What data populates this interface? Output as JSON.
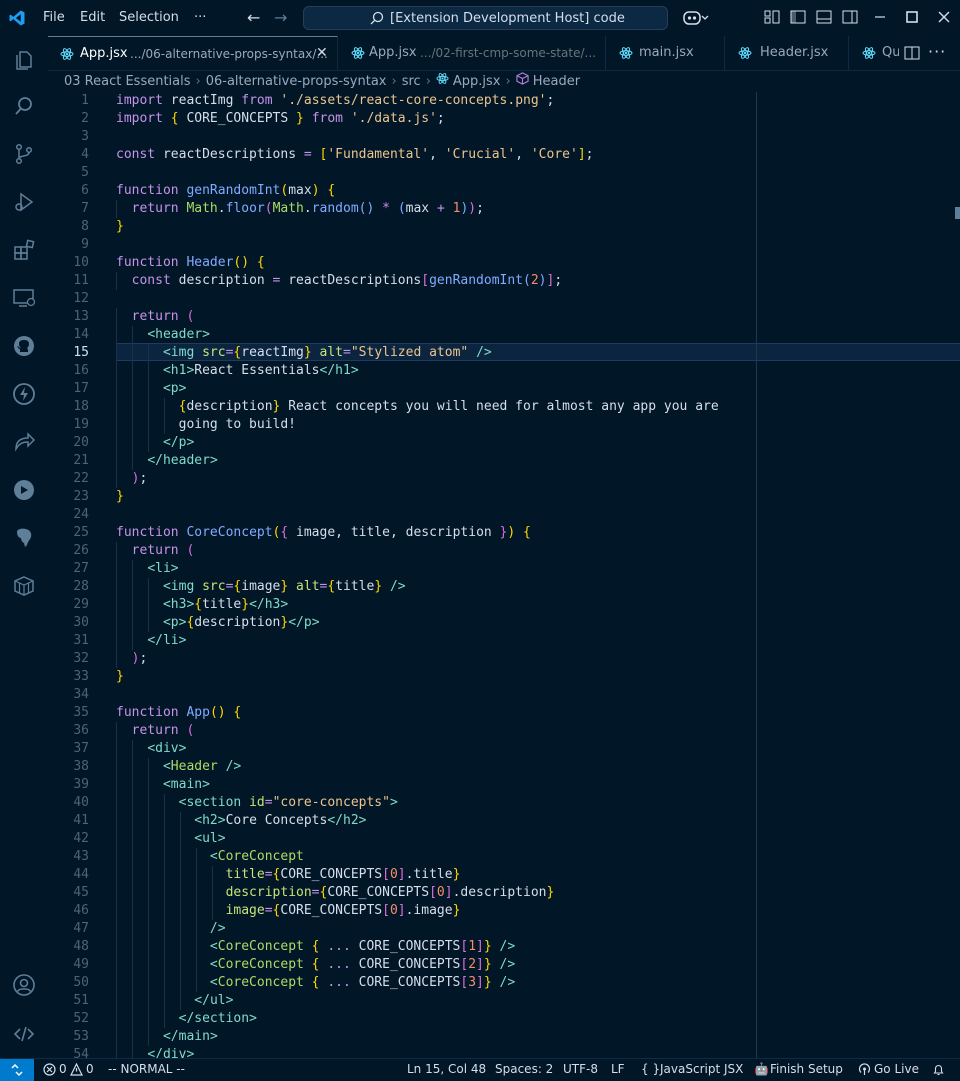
{
  "titlebar": {
    "menu": [
      "File",
      "Edit",
      "Selection",
      "···"
    ],
    "command_center": "[Extension Development Host] code"
  },
  "tabs": [
    {
      "name": "App.jsx",
      "path": ".../06-alternative-props-syntax/...",
      "active": true
    },
    {
      "name": "App.jsx",
      "path": ".../02-first-cmp-some-state/...",
      "active": false
    },
    {
      "name": "main.jsx",
      "path": "",
      "active": false
    },
    {
      "name": "Header.jsx",
      "path": "",
      "active": false
    },
    {
      "name": "Qu",
      "path": "",
      "active": false
    }
  ],
  "breadcrumb": [
    "03 React Essentials",
    "06-alternative-props-syntax",
    "src",
    "App.jsx",
    "Header"
  ],
  "editor": {
    "current_line": 15,
    "line_numbers": [
      "1",
      "2",
      "3",
      "4",
      "5",
      "6",
      "7",
      "8",
      "9",
      "10",
      "11",
      "12",
      "13",
      "14",
      "15",
      "16",
      "17",
      "18",
      "19",
      "20",
      "21",
      "22",
      "23",
      "24",
      "25",
      "26",
      "27",
      "28",
      "29",
      "30",
      "31",
      "32",
      "33",
      "34",
      "35",
      "36",
      "37",
      "38",
      "39",
      "40",
      "41",
      "42",
      "43",
      "44",
      "45",
      "46",
      "47",
      "48",
      "49",
      "50",
      "51",
      "52",
      "53",
      "54"
    ],
    "lines": [
      [
        [
          "k",
          "import "
        ],
        [
          "v",
          "reactImg "
        ],
        [
          "k",
          "from "
        ],
        [
          "s",
          "'./assets/react-core-concepts.png'"
        ],
        [
          "v",
          ";"
        ]
      ],
      [
        [
          "k",
          "import "
        ],
        [
          "p",
          "{ "
        ],
        [
          "v",
          "CORE_CONCEPTS "
        ],
        [
          "p",
          "} "
        ],
        [
          "k",
          "from "
        ],
        [
          "s",
          "'./data.js'"
        ],
        [
          "v",
          ";"
        ]
      ],
      [],
      [
        [
          "k",
          "const "
        ],
        [
          "v",
          "reactDescriptions "
        ],
        [
          "k",
          "= "
        ],
        [
          "p",
          "["
        ],
        [
          "s",
          "'Fundamental'"
        ],
        [
          "v",
          ", "
        ],
        [
          "s",
          "'Crucial'"
        ],
        [
          "v",
          ", "
        ],
        [
          "s",
          "'Core'"
        ],
        [
          "p",
          "]"
        ],
        [
          "v",
          ";"
        ]
      ],
      [],
      [
        [
          "k",
          "function "
        ],
        [
          "f",
          "genRandomInt"
        ],
        [
          "p",
          "("
        ],
        [
          "v",
          "max"
        ],
        [
          "p",
          ") {"
        ]
      ],
      [
        [
          "v",
          "  "
        ],
        [
          "k",
          "return "
        ],
        [
          "c",
          "Math"
        ],
        [
          "v",
          "."
        ],
        [
          "f",
          "floor"
        ],
        [
          "br2",
          "("
        ],
        [
          "c",
          "Math"
        ],
        [
          "v",
          "."
        ],
        [
          "f",
          "random"
        ],
        [
          "f",
          "() "
        ],
        [
          "k",
          "* "
        ],
        [
          "f",
          "("
        ],
        [
          "v",
          "max "
        ],
        [
          "k",
          "+ "
        ],
        [
          "n",
          "1"
        ],
        [
          "f",
          ")"
        ],
        [
          "br2",
          ")"
        ],
        [
          "v",
          ";"
        ]
      ],
      [
        [
          "p",
          "}"
        ]
      ],
      [],
      [
        [
          "k",
          "function "
        ],
        [
          "f",
          "Header"
        ],
        [
          "p",
          "() {"
        ]
      ],
      [
        [
          "v",
          "  "
        ],
        [
          "k",
          "const "
        ],
        [
          "v",
          "description "
        ],
        [
          "k",
          "= "
        ],
        [
          "v",
          "reactDescriptions"
        ],
        [
          "br2",
          "["
        ],
        [
          "f",
          "genRandomInt"
        ],
        [
          "f",
          "("
        ],
        [
          "n",
          "2"
        ],
        [
          "f",
          ")"
        ],
        [
          "br2",
          "]"
        ],
        [
          "v",
          ";"
        ]
      ],
      [],
      [
        [
          "v",
          "  "
        ],
        [
          "k",
          "return "
        ],
        [
          "br2",
          "("
        ]
      ],
      [
        [
          "v",
          "    "
        ],
        [
          "t",
          "<"
        ],
        [
          "t",
          "header"
        ],
        [
          "t",
          ">"
        ]
      ],
      [
        [
          "v",
          "      "
        ],
        [
          "t",
          "<"
        ],
        [
          "t",
          "img "
        ],
        [
          "a",
          "src"
        ],
        [
          "k",
          "="
        ],
        [
          "p",
          "{"
        ],
        [
          "v",
          "reactImg"
        ],
        [
          "p",
          "} "
        ],
        [
          "a",
          "alt"
        ],
        [
          "k",
          "="
        ],
        [
          "s",
          "\"Stylized atom\" "
        ],
        [
          "t",
          "/>"
        ]
      ],
      [
        [
          "v",
          "      "
        ],
        [
          "t",
          "<"
        ],
        [
          "t",
          "h1"
        ],
        [
          "t",
          ">"
        ],
        [
          "v",
          "React Essentials"
        ],
        [
          "t",
          "</"
        ],
        [
          "t",
          "h1"
        ],
        [
          "t",
          ">"
        ]
      ],
      [
        [
          "v",
          "      "
        ],
        [
          "t",
          "<"
        ],
        [
          "t",
          "p"
        ],
        [
          "t",
          ">"
        ]
      ],
      [
        [
          "v",
          "        "
        ],
        [
          "p",
          "{"
        ],
        [
          "v",
          "description"
        ],
        [
          "p",
          "} "
        ],
        [
          "v",
          "React concepts you will need for almost any app you are"
        ]
      ],
      [
        [
          "v",
          "        going to build!"
        ]
      ],
      [
        [
          "v",
          "      "
        ],
        [
          "t",
          "</"
        ],
        [
          "t",
          "p"
        ],
        [
          "t",
          ">"
        ]
      ],
      [
        [
          "v",
          "    "
        ],
        [
          "t",
          "</"
        ],
        [
          "t",
          "header"
        ],
        [
          "t",
          ">"
        ]
      ],
      [
        [
          "v",
          "  "
        ],
        [
          "br2",
          ")"
        ],
        [
          "v",
          ";"
        ]
      ],
      [
        [
          "p",
          "}"
        ]
      ],
      [],
      [
        [
          "k",
          "function "
        ],
        [
          "f",
          "CoreConcept"
        ],
        [
          "p",
          "("
        ],
        [
          "br2",
          "{ "
        ],
        [
          "v",
          "image"
        ],
        [
          "v",
          ", "
        ],
        [
          "v",
          "title"
        ],
        [
          "v",
          ", "
        ],
        [
          "v",
          "description "
        ],
        [
          "br2",
          "}"
        ],
        [
          "p",
          ") {"
        ]
      ],
      [
        [
          "v",
          "  "
        ],
        [
          "k",
          "return "
        ],
        [
          "br2",
          "("
        ]
      ],
      [
        [
          "v",
          "    "
        ],
        [
          "t",
          "<"
        ],
        [
          "t",
          "li"
        ],
        [
          "t",
          ">"
        ]
      ],
      [
        [
          "v",
          "      "
        ],
        [
          "t",
          "<"
        ],
        [
          "t",
          "img "
        ],
        [
          "a",
          "src"
        ],
        [
          "k",
          "="
        ],
        [
          "p",
          "{"
        ],
        [
          "v",
          "image"
        ],
        [
          "p",
          "} "
        ],
        [
          "a",
          "alt"
        ],
        [
          "k",
          "="
        ],
        [
          "p",
          "{"
        ],
        [
          "v",
          "title"
        ],
        [
          "p",
          "} "
        ],
        [
          "t",
          "/>"
        ]
      ],
      [
        [
          "v",
          "      "
        ],
        [
          "t",
          "<"
        ],
        [
          "t",
          "h3"
        ],
        [
          "t",
          ">"
        ],
        [
          "p",
          "{"
        ],
        [
          "v",
          "title"
        ],
        [
          "p",
          "}"
        ],
        [
          "t",
          "</"
        ],
        [
          "t",
          "h3"
        ],
        [
          "t",
          ">"
        ]
      ],
      [
        [
          "v",
          "      "
        ],
        [
          "t",
          "<"
        ],
        [
          "t",
          "p"
        ],
        [
          "t",
          ">"
        ],
        [
          "p",
          "{"
        ],
        [
          "v",
          "description"
        ],
        [
          "p",
          "}"
        ],
        [
          "t",
          "</"
        ],
        [
          "t",
          "p"
        ],
        [
          "t",
          ">"
        ]
      ],
      [
        [
          "v",
          "    "
        ],
        [
          "t",
          "</"
        ],
        [
          "t",
          "li"
        ],
        [
          "t",
          ">"
        ]
      ],
      [
        [
          "v",
          "  "
        ],
        [
          "br2",
          ")"
        ],
        [
          "v",
          ";"
        ]
      ],
      [
        [
          "p",
          "}"
        ]
      ],
      [],
      [
        [
          "k",
          "function "
        ],
        [
          "f",
          "App"
        ],
        [
          "p",
          "() {"
        ]
      ],
      [
        [
          "v",
          "  "
        ],
        [
          "k",
          "return "
        ],
        [
          "br2",
          "("
        ]
      ],
      [
        [
          "v",
          "    "
        ],
        [
          "t",
          "<"
        ],
        [
          "t",
          "div"
        ],
        [
          "t",
          ">"
        ]
      ],
      [
        [
          "v",
          "      "
        ],
        [
          "t",
          "<"
        ],
        [
          "c",
          "Header "
        ],
        [
          "t",
          "/>"
        ]
      ],
      [
        [
          "v",
          "      "
        ],
        [
          "t",
          "<"
        ],
        [
          "t",
          "main"
        ],
        [
          "t",
          ">"
        ]
      ],
      [
        [
          "v",
          "        "
        ],
        [
          "t",
          "<"
        ],
        [
          "t",
          "section "
        ],
        [
          "a",
          "id"
        ],
        [
          "k",
          "="
        ],
        [
          "s",
          "\"core-concepts\""
        ],
        [
          "t",
          ">"
        ]
      ],
      [
        [
          "v",
          "          "
        ],
        [
          "t",
          "<"
        ],
        [
          "t",
          "h2"
        ],
        [
          "t",
          ">"
        ],
        [
          "v",
          "Core Concepts"
        ],
        [
          "t",
          "</"
        ],
        [
          "t",
          "h2"
        ],
        [
          "t",
          ">"
        ]
      ],
      [
        [
          "v",
          "          "
        ],
        [
          "t",
          "<"
        ],
        [
          "t",
          "ul"
        ],
        [
          "t",
          ">"
        ]
      ],
      [
        [
          "v",
          "            "
        ],
        [
          "t",
          "<"
        ],
        [
          "c",
          "CoreConcept"
        ]
      ],
      [
        [
          "v",
          "              "
        ],
        [
          "a",
          "title"
        ],
        [
          "k",
          "="
        ],
        [
          "p",
          "{"
        ],
        [
          "v",
          "CORE_CONCEPTS"
        ],
        [
          "br2",
          "["
        ],
        [
          "n",
          "0"
        ],
        [
          "br2",
          "]"
        ],
        [
          "v",
          ".title"
        ],
        [
          "p",
          "}"
        ]
      ],
      [
        [
          "v",
          "              "
        ],
        [
          "a",
          "description"
        ],
        [
          "k",
          "="
        ],
        [
          "p",
          "{"
        ],
        [
          "v",
          "CORE_CONCEPTS"
        ],
        [
          "br2",
          "["
        ],
        [
          "n",
          "0"
        ],
        [
          "br2",
          "]"
        ],
        [
          "v",
          ".description"
        ],
        [
          "p",
          "}"
        ]
      ],
      [
        [
          "v",
          "              "
        ],
        [
          "a",
          "image"
        ],
        [
          "k",
          "="
        ],
        [
          "p",
          "{"
        ],
        [
          "v",
          "CORE_CONCEPTS"
        ],
        [
          "br2",
          "["
        ],
        [
          "n",
          "0"
        ],
        [
          "br2",
          "]"
        ],
        [
          "v",
          ".image"
        ],
        [
          "p",
          "}"
        ]
      ],
      [
        [
          "v",
          "            "
        ],
        [
          "t",
          "/>"
        ]
      ],
      [
        [
          "v",
          "            "
        ],
        [
          "t",
          "<"
        ],
        [
          "c",
          "CoreConcept "
        ],
        [
          "p",
          "{ "
        ],
        [
          "k",
          "... "
        ],
        [
          "v",
          "CORE_CONCEPTS"
        ],
        [
          "br2",
          "["
        ],
        [
          "n",
          "1"
        ],
        [
          "br2",
          "]"
        ],
        [
          "p",
          "} "
        ],
        [
          "t",
          "/>"
        ]
      ],
      [
        [
          "v",
          "            "
        ],
        [
          "t",
          "<"
        ],
        [
          "c",
          "CoreConcept "
        ],
        [
          "p",
          "{ "
        ],
        [
          "k",
          "... "
        ],
        [
          "v",
          "CORE_CONCEPTS"
        ],
        [
          "br2",
          "["
        ],
        [
          "n",
          "2"
        ],
        [
          "br2",
          "]"
        ],
        [
          "p",
          "} "
        ],
        [
          "t",
          "/>"
        ]
      ],
      [
        [
          "v",
          "            "
        ],
        [
          "t",
          "<"
        ],
        [
          "c",
          "CoreConcept "
        ],
        [
          "p",
          "{ "
        ],
        [
          "k",
          "... "
        ],
        [
          "v",
          "CORE_CONCEPTS"
        ],
        [
          "br2",
          "["
        ],
        [
          "n",
          "3"
        ],
        [
          "br2",
          "]"
        ],
        [
          "p",
          "} "
        ],
        [
          "t",
          "/>"
        ]
      ],
      [
        [
          "v",
          "          "
        ],
        [
          "t",
          "</"
        ],
        [
          "t",
          "ul"
        ],
        [
          "t",
          ">"
        ]
      ],
      [
        [
          "v",
          "        "
        ],
        [
          "t",
          "</"
        ],
        [
          "t",
          "section"
        ],
        [
          "t",
          ">"
        ]
      ],
      [
        [
          "v",
          "      "
        ],
        [
          "t",
          "</"
        ],
        [
          "t",
          "main"
        ],
        [
          "t",
          ">"
        ]
      ],
      [
        [
          "v",
          "    "
        ],
        [
          "t",
          "</"
        ],
        [
          "t",
          "div"
        ],
        [
          "t",
          ">"
        ]
      ]
    ]
  },
  "statusbar": {
    "problems_errors": "0",
    "problems_warnings": "0",
    "vim_mode": "-- NORMAL --",
    "cursor_position": "Ln 15, Col 48",
    "indentation": "Spaces: 2",
    "encoding": "UTF-8",
    "eol": "LF",
    "language": "JavaScript JSX",
    "finish_setup": "Finish Setup",
    "go_live": "Go Live"
  },
  "colors": {
    "background": "#011627",
    "keyword": "#c792ea",
    "function": "#82aaff",
    "string": "#ecc48d",
    "number": "#f78c6c",
    "tag": "#7fdbca",
    "attribute": "#c5e478",
    "remote_indicator": "#007acc"
  }
}
